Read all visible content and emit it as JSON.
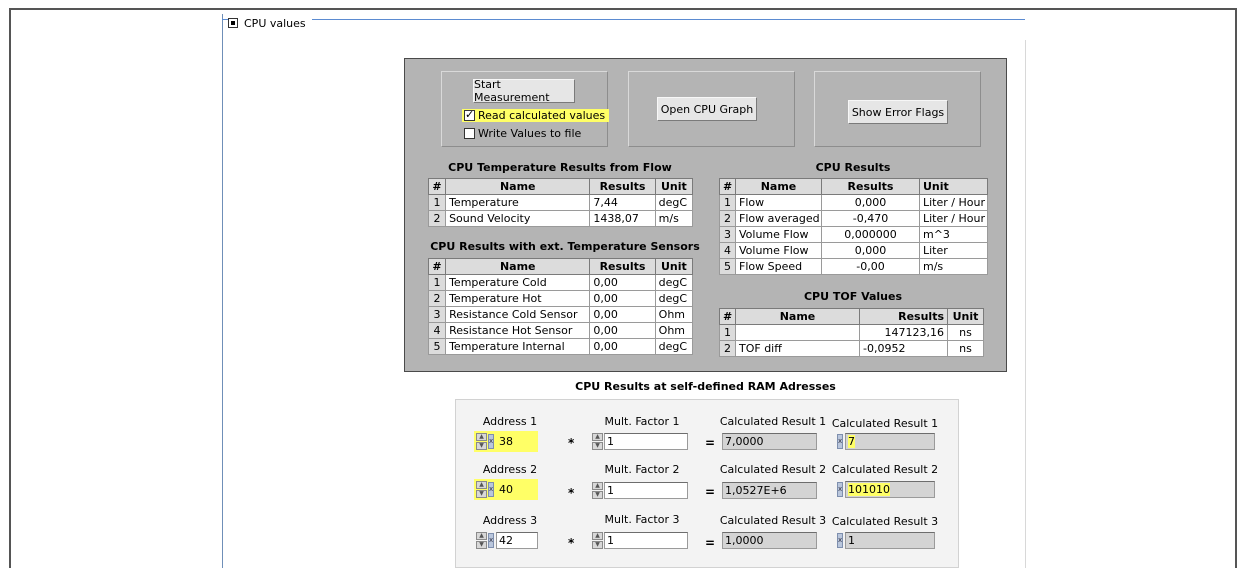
{
  "window": {
    "title": "CPU values"
  },
  "buttons": {
    "start_measurement": "Start Measurement",
    "open_cpu_graph": "Open CPU Graph",
    "show_error_flags": "Show Error Flags"
  },
  "checkboxes": {
    "read_calculated": {
      "label": "Read calculated values",
      "checked": true
    },
    "write_to_file": {
      "label": "Write Values to file",
      "checked": false
    }
  },
  "temp_from_flow": {
    "title": "CPU Temperature Results from Flow",
    "headers": [
      "#",
      "Name",
      "Results",
      "Unit"
    ],
    "rows": [
      [
        "1",
        "Temperature",
        "7,44",
        "degC"
      ],
      [
        "2",
        "Sound Velocity",
        "1438,07",
        "m/s"
      ]
    ]
  },
  "ext_temp": {
    "title": "CPU Results with ext. Temperature Sensors",
    "headers": [
      "#",
      "Name",
      "Results",
      "Unit"
    ],
    "rows": [
      [
        "1",
        "Temperature Cold",
        "0,00",
        "degC"
      ],
      [
        "2",
        "Temperature Hot",
        "0,00",
        "degC"
      ],
      [
        "3",
        "Resistance Cold Sensor",
        "0,00",
        "Ohm"
      ],
      [
        "4",
        "Resistance Hot Sensor",
        "0,00",
        "Ohm"
      ],
      [
        "5",
        "Temperature Internal",
        "0,00",
        "degC"
      ]
    ]
  },
  "cpu_results": {
    "title": "CPU Results",
    "headers": [
      "#",
      "Name",
      "Results",
      "Unit"
    ],
    "rows": [
      [
        "1",
        "Flow",
        "0,000",
        "Liter / Hour"
      ],
      [
        "2",
        "Flow averaged",
        "-0,470",
        "Liter / Hour"
      ],
      [
        "3",
        "Volume Flow",
        "0,000000",
        "m^3"
      ],
      [
        "4",
        "Volume Flow",
        "0,000",
        "Liter"
      ],
      [
        "5",
        "Flow Speed",
        "-0,00",
        "m/s"
      ]
    ]
  },
  "tof_values": {
    "title": "CPU TOF Values",
    "headers": [
      "#",
      "Name",
      "Results",
      "Unit"
    ],
    "rows": [
      [
        "1",
        "",
        "147123,16",
        "ns"
      ],
      [
        "2",
        "TOF diff",
        "-0,0952",
        "ns"
      ]
    ]
  },
  "ram": {
    "title": "CPU Results at self-defined RAM Adresses",
    "operators": {
      "multiply": "*",
      "equals": "="
    },
    "radix_marker": "x",
    "rows": [
      {
        "address_label": "Address 1",
        "address": "38",
        "factor_label": "Mult. Factor 1",
        "factor": "1",
        "calc_label": "Calculated Result 1",
        "calc": "7,0000",
        "calc2_label": "Calculated Result 1",
        "calc2": "7"
      },
      {
        "address_label": "Address 2",
        "address": "40",
        "factor_label": "Mult. Factor 2",
        "factor": "1",
        "calc_label": "Calculated Result 2",
        "calc": "1,0527E+6",
        "calc2_label": "Calculated Result 2",
        "calc2": "101010"
      },
      {
        "address_label": "Address 3",
        "address": "42",
        "factor_label": "Mult. Factor 3",
        "factor": "1",
        "calc_label": "Calculated Result 3",
        "calc": "1,0000",
        "calc2_label": "Calculated Result 3",
        "calc2": "1"
      }
    ]
  }
}
